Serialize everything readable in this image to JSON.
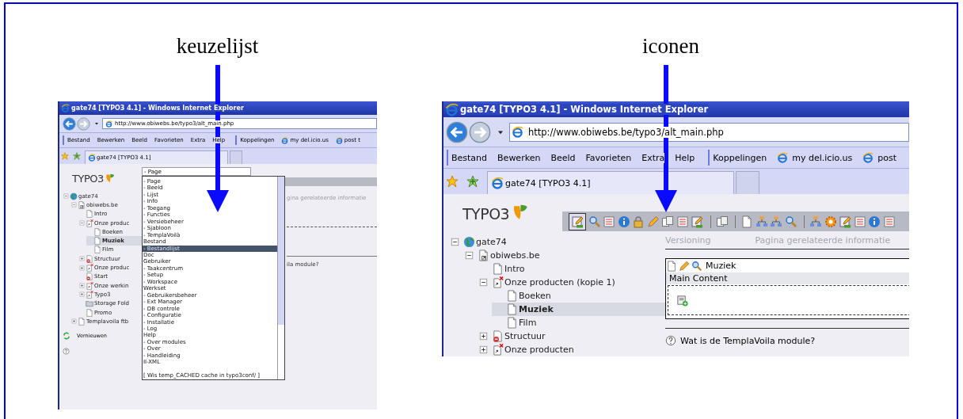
{
  "panels": [
    {
      "caption": "keuzelijst",
      "screenshot": {
        "kind": "dropdown",
        "title": "gate74 [TYPO3 4.1] - Windows Internet Explorer",
        "address": "http://www.obiwebs.be/typo3/alt_main.php",
        "menu": [
          "Bestand",
          "Bewerken",
          "Beeld",
          "Favorieten",
          "Extra",
          "Help"
        ],
        "links_label": "Koppelingen",
        "links": [
          "my del.icio.us",
          "post t"
        ],
        "tab": "gate74 [TYPO3 4.1]",
        "logo": "TYPO3",
        "tree": [
          {
            "label": "gate74",
            "kind": "globe",
            "collapsed": false,
            "selected": false,
            "children": [
              {
                "label": "obiwebs.be",
                "kind": "shortcut",
                "collapsed": false,
                "selected": false,
                "children": [
                  {
                    "label": "Intro",
                    "kind": "page",
                    "collapsed": false,
                    "selected": false
                  },
                  {
                    "label": "Onze produc",
                    "kind": "deleted",
                    "collapsed": false,
                    "selected": false,
                    "children": [
                      {
                        "label": "Boeken",
                        "kind": "page",
                        "collapsed": false,
                        "selected": false
                      },
                      {
                        "label": "Muziek",
                        "kind": "page",
                        "collapsed": false,
                        "selected": true
                      },
                      {
                        "label": "Film",
                        "kind": "page",
                        "collapsed": false,
                        "selected": false
                      }
                    ]
                  },
                  {
                    "label": "Structuur",
                    "kind": "hidden",
                    "collapsed": true,
                    "selected": false
                  },
                  {
                    "label": "Onze produc",
                    "kind": "deleted",
                    "collapsed": true,
                    "selected": false
                  },
                  {
                    "label": "Start",
                    "kind": "hidden",
                    "collapsed": false,
                    "selected": false
                  },
                  {
                    "label": "Onze werkin",
                    "kind": "deleted",
                    "collapsed": true,
                    "selected": false
                  },
                  {
                    "label": "Typo3",
                    "kind": "deleted",
                    "collapsed": true,
                    "selected": false
                  },
                  {
                    "label": "Storage Fold",
                    "kind": "folder",
                    "collapsed": false,
                    "selected": false
                  },
                  {
                    "label": "Promo",
                    "kind": "page",
                    "collapsed": false,
                    "selected": false
                  }
                ]
              },
              {
                "label": "Templavoila ftb",
                "kind": "page",
                "collapsed": true,
                "selected": false
              }
            ]
          }
        ],
        "refresh": "Vernieuwen",
        "module_select": "- Page",
        "options": [
          {
            "text": "- Page",
            "selected": false
          },
          {
            "text": "- Beeld",
            "selected": false
          },
          {
            "text": "- Lijst",
            "selected": false
          },
          {
            "text": "- Info",
            "selected": false
          },
          {
            "text": "- Toegang",
            "selected": false
          },
          {
            "text": "- Functies",
            "selected": false
          },
          {
            "text": "- Versiebeheer",
            "selected": false
          },
          {
            "text": "- Sjabloon",
            "selected": false
          },
          {
            "text": "- TemplaVoilà",
            "selected": false
          },
          {
            "text": "Bestand",
            "selected": false
          },
          {
            "text": "- Bestandlijst",
            "selected": true
          },
          {
            "text": "Doc",
            "selected": false
          },
          {
            "text": "Gebruiker",
            "selected": false
          },
          {
            "text": "- Taakcentrum",
            "selected": false
          },
          {
            "text": "- Setup",
            "selected": false
          },
          {
            "text": "- Workspace",
            "selected": false
          },
          {
            "text": "Werkset",
            "selected": false
          },
          {
            "text": "- Gebruikersbeheer",
            "selected": false
          },
          {
            "text": "- Ext Manager",
            "selected": false
          },
          {
            "text": "- DB controle",
            "selected": false
          },
          {
            "text": "- Configuratie",
            "selected": false
          },
          {
            "text": "- Installatie",
            "selected": false
          },
          {
            "text": "- Log",
            "selected": false
          },
          {
            "text": "Help",
            "selected": false
          },
          {
            "text": "- Over modules",
            "selected": false
          },
          {
            "text": "- Over",
            "selected": false
          },
          {
            "text": "- Handleiding",
            "selected": false
          },
          {
            "text": "II-XML",
            "selected": false
          },
          {
            "text": "[ Wis temp_CACHED cache in typo3conf/ ]",
            "selected": false
          }
        ],
        "background_texts": [
          "gina gerelateerde informatie",
          "ila module?"
        ]
      }
    },
    {
      "caption": "iconen",
      "screenshot": {
        "kind": "icons",
        "title": "gate74 [TYPO3 4.1] - Windows Internet Explorer",
        "address": "http://www.obiwebs.be/typo3/alt_main.php",
        "menu": [
          "Bestand",
          "Bewerken",
          "Beeld",
          "Favorieten",
          "Extra",
          "Help"
        ],
        "links_label": "Koppelingen",
        "links": [
          "my del.icio.us",
          "post"
        ],
        "tab": "gate74 [TYPO3 4.1]",
        "logo": "TYPO3",
        "tree": [
          {
            "label": "gate74",
            "kind": "globe",
            "collapsed": false,
            "selected": false,
            "children": [
              {
                "label": "obiwebs.be",
                "kind": "shortcut",
                "collapsed": false,
                "selected": false,
                "children": [
                  {
                    "label": "Intro",
                    "kind": "page",
                    "collapsed": false,
                    "selected": false
                  },
                  {
                    "label": "Onze producten (kopie 1)",
                    "kind": "deleted",
                    "collapsed": false,
                    "selected": false,
                    "children": [
                      {
                        "label": "Boeken",
                        "kind": "page",
                        "collapsed": false,
                        "selected": false
                      },
                      {
                        "label": "Muziek",
                        "kind": "page",
                        "collapsed": false,
                        "selected": true
                      },
                      {
                        "label": "Film",
                        "kind": "page",
                        "collapsed": false,
                        "selected": false
                      }
                    ]
                  },
                  {
                    "label": "Structuur",
                    "kind": "hidden",
                    "collapsed": true,
                    "selected": false
                  },
                  {
                    "label": "Onze producten",
                    "kind": "deleted",
                    "collapsed": true,
                    "selected": false
                  }
                ]
              }
            ]
          }
        ],
        "content_tabs": [
          "Versioning",
          "Pagina gerelateerde informatie"
        ],
        "element": {
          "title": "Muziek",
          "section": "Main Content"
        },
        "help": "Wat is de TemplaVoila module?"
      }
    }
  ]
}
